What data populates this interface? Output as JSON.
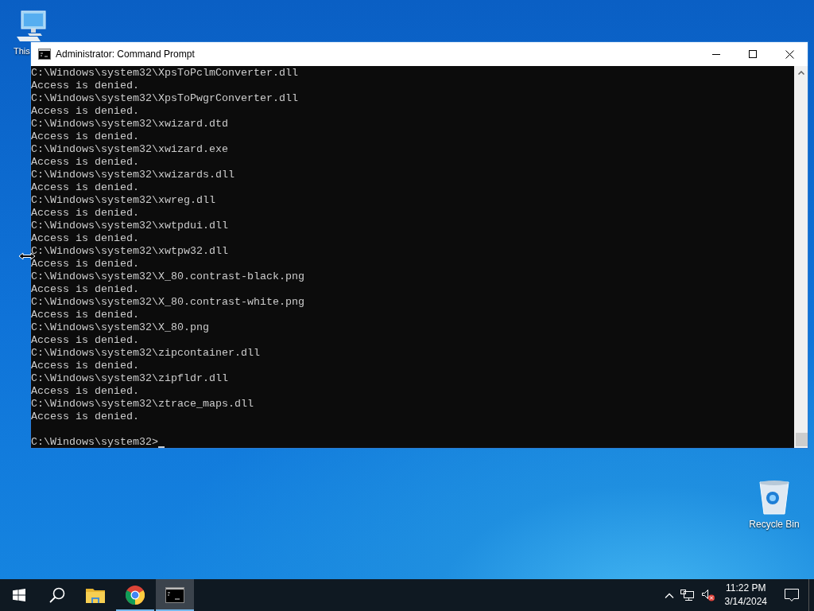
{
  "desktop_icons": [
    {
      "kind": "computer",
      "label": "This"
    },
    {
      "kind": "recycle-bin",
      "label": "Recycle Bin"
    }
  ],
  "window": {
    "title": "Administrator: Command Prompt"
  },
  "console": {
    "lines": [
      "C:\\Windows\\system32\\XpsToPclmConverter.dll",
      "Access is denied.",
      "C:\\Windows\\system32\\XpsToPwgrConverter.dll",
      "Access is denied.",
      "C:\\Windows\\system32\\xwizard.dtd",
      "Access is denied.",
      "C:\\Windows\\system32\\xwizard.exe",
      "Access is denied.",
      "C:\\Windows\\system32\\xwizards.dll",
      "Access is denied.",
      "C:\\Windows\\system32\\xwreg.dll",
      "Access is denied.",
      "C:\\Windows\\system32\\xwtpdui.dll",
      "Access is denied.",
      "C:\\Windows\\system32\\xwtpw32.dll",
      "Access is denied.",
      "C:\\Windows\\system32\\X_80.contrast-black.png",
      "Access is denied.",
      "C:\\Windows\\system32\\X_80.contrast-white.png",
      "Access is denied.",
      "C:\\Windows\\system32\\X_80.png",
      "Access is denied.",
      "C:\\Windows\\system32\\zipcontainer.dll",
      "Access is denied.",
      "C:\\Windows\\system32\\zipfldr.dll",
      "Access is denied.",
      "C:\\Windows\\system32\\ztrace_maps.dll",
      "Access is denied."
    ],
    "prompt": "C:\\Windows\\system32>"
  },
  "taskbar": {
    "apps": [
      {
        "kind": "explorer",
        "running": false,
        "selected": false
      },
      {
        "kind": "chrome",
        "running": true,
        "selected": false
      },
      {
        "kind": "terminal",
        "running": true,
        "selected": true
      }
    ],
    "clock": {
      "time": "11:22 PM",
      "date": "3/14/2024"
    }
  }
}
